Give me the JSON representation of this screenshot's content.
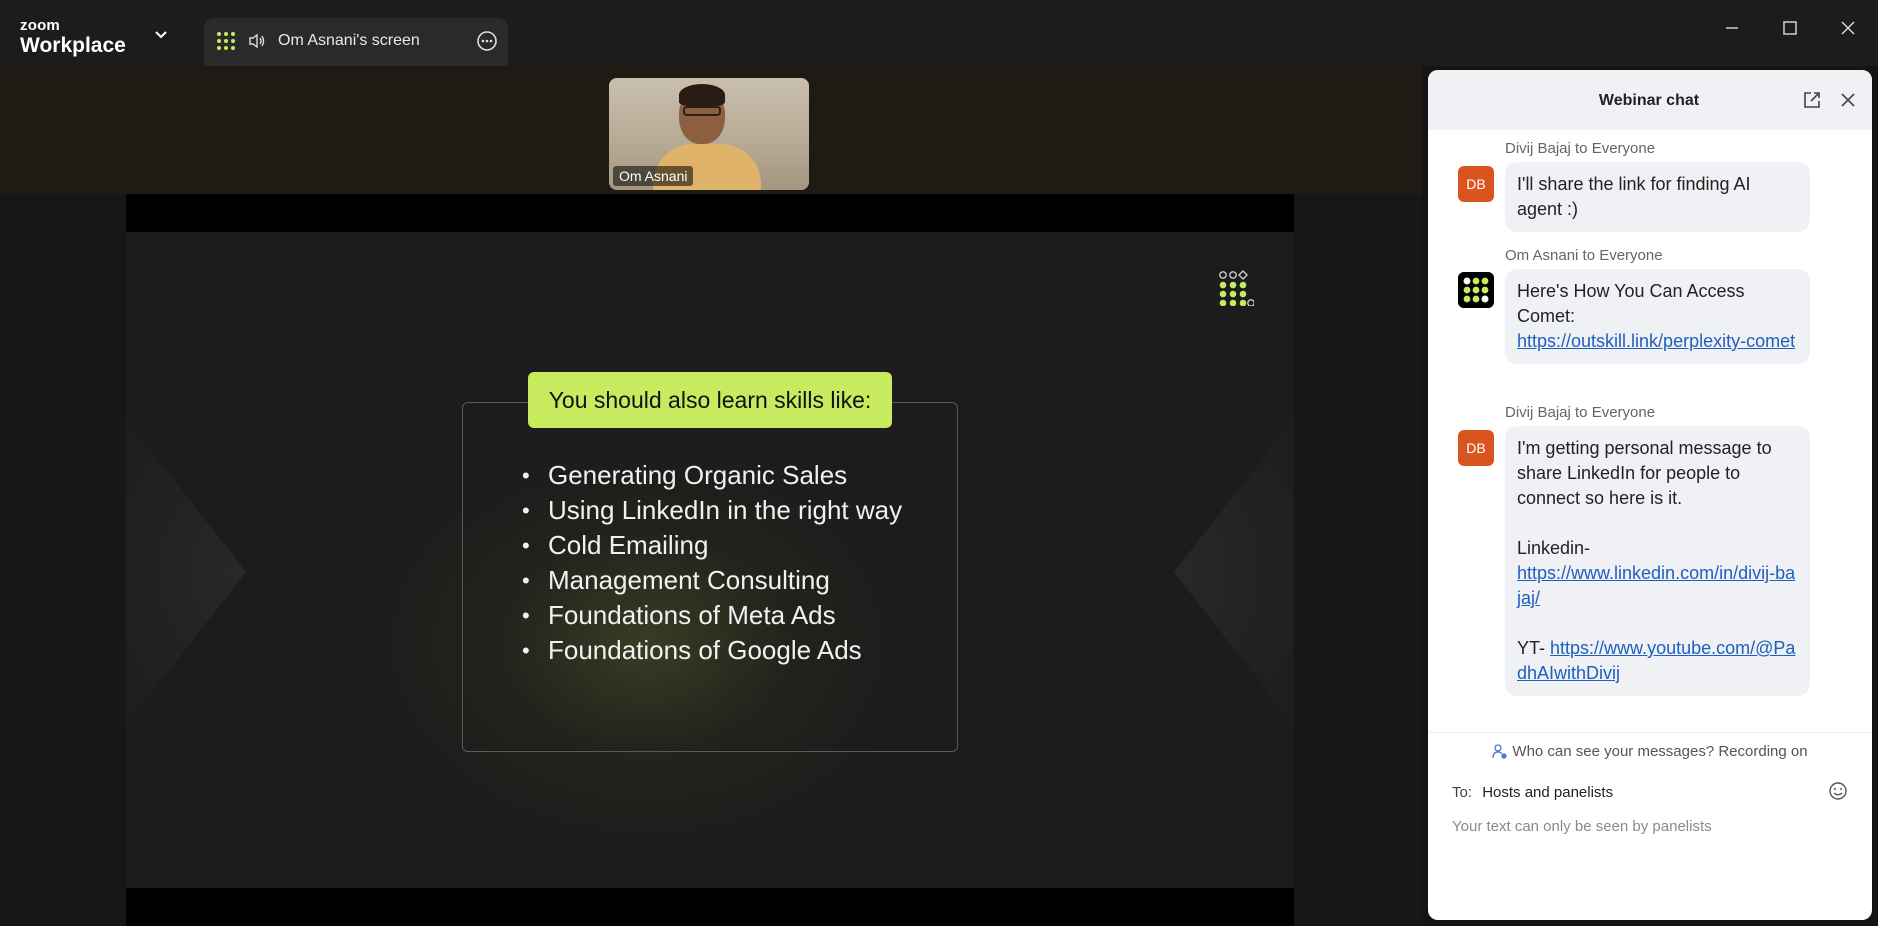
{
  "titlebar": {
    "brand_small": "zoom",
    "brand_large": "Workplace",
    "tab_label": "Om Asnani's screen"
  },
  "video": {
    "participant_name": "Om Asnani"
  },
  "slide": {
    "heading": "You should also learn skills like:",
    "skills": [
      "Generating Organic Sales",
      "Using LinkedIn in the right way",
      "Cold Emailing",
      "Management Consulting",
      "Foundations of Meta Ads",
      "Foundations of Google Ads"
    ],
    "accent_color": "#c7ea5f"
  },
  "chat": {
    "title": "Webinar chat",
    "messages": [
      {
        "sender": "Divij Bajaj to Everyone",
        "initials": "DB",
        "text": "I'll share the link for finding AI agent :)"
      },
      {
        "sender": "Om Asnani to Everyone",
        "text": "Here's How You Can Access Comet:",
        "link": "https://outskill.link/perplexity-comet"
      },
      {
        "sender": "Divij Bajaj to Everyone",
        "initials": "DB",
        "text": "I'm getting personal message to share LinkedIn for people to connect so here is it.",
        "linkedin_label": "Linkedin-",
        "linkedin_url": "https://www.linkedin.com/in/divij-bajaj/",
        "yt_label": "YT-",
        "yt_url": "https://www.youtube.com/@PadhAIwithDivij"
      }
    ],
    "notice": "Who can see your messages? Recording on",
    "to_label": "To:",
    "to_value": "Hosts and panelists",
    "compose_placeholder": "Your text can only be seen by panelists",
    "avatar_color": "#d9541e",
    "link_color": "#1f5fbf"
  }
}
